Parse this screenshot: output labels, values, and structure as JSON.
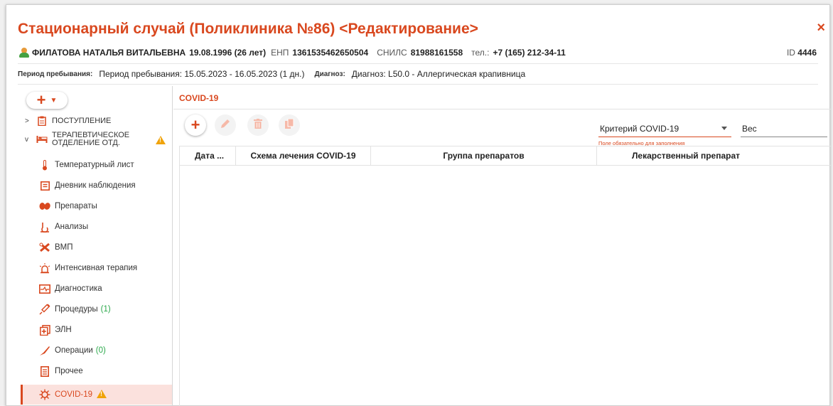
{
  "header": {
    "title": "Стационарный случай (Поликлиника №86) <Редактирование>",
    "close_label": "×"
  },
  "patient": {
    "name": "ФИЛАТОВА НАТАЛЬЯ ВИТАЛЬЕВНА",
    "dob": "19.08.1996 (26 лет)",
    "enp_label": "ЕНП",
    "enp": "1361535462650504",
    "snils_label": "СНИЛС",
    "snils": "81988161558",
    "phone_label": "тел.:",
    "phone": "+7 (165) 212-34-11",
    "id_label": "ID",
    "id": "4446"
  },
  "info": {
    "period_label": "Период пребывания:",
    "period_value": "Период пребывания: 15.05.2023 - 16.05.2023 (1 дн.)",
    "diag_label": "Диагноз:",
    "diag_value": "Диагноз: L50.0 - Аллергическая крапивница"
  },
  "sidebar": {
    "add_icon": "plus-icon",
    "tree": [
      {
        "label": "ПОСТУПЛЕНИЕ",
        "icon": "clipboard-icon"
      },
      {
        "label_line1": "ТЕРАПЕВТИЧЕСКОЕ",
        "label_line2": "ОТДЕЛЕНИЕ ОТД.",
        "icon": "bed-icon",
        "warning": true
      }
    ],
    "items": [
      {
        "label": "Температурный лист",
        "icon": "thermometer-icon"
      },
      {
        "label": "Дневник наблюдения",
        "icon": "journal-icon"
      },
      {
        "label": "Препараты",
        "icon": "pills-icon"
      },
      {
        "label": "Анализы",
        "icon": "flask-icon"
      },
      {
        "label": "ВМП",
        "icon": "tools-icon"
      },
      {
        "label": "Интенсивная терапия",
        "icon": "alarm-icon"
      },
      {
        "label": "Диагностика",
        "icon": "monitor-icon"
      },
      {
        "label": "Процедуры",
        "count": "(1)",
        "icon": "syringe-icon"
      },
      {
        "label": "ЭЛН",
        "icon": "sick-leave-icon"
      },
      {
        "label": "Операции",
        "count": "(0)",
        "icon": "scalpel-icon"
      },
      {
        "label": "Прочее",
        "icon": "document-icon"
      },
      {
        "label": "COVID-19",
        "icon": "virus-icon",
        "warning": true,
        "active": true
      }
    ]
  },
  "main": {
    "section_title": "COVID-19",
    "criteria": {
      "value": "Критерий COVID-19",
      "hint": "Поле обязательно для заполнения"
    },
    "weight": {
      "value": "Вес"
    },
    "columns": [
      "Дата ...",
      "Схема лечения COVID-19",
      "Группа препаратов",
      "Лекарственный препарат"
    ]
  },
  "colors": {
    "accent": "#d9481f",
    "warning": "#f0a30a",
    "count": "#2aa84a",
    "active_bg": "#fbe1dd"
  }
}
